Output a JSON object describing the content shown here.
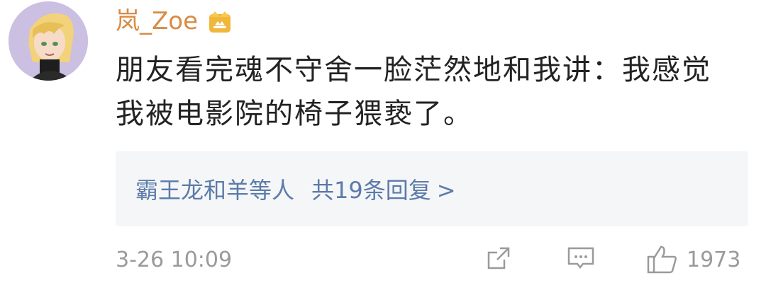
{
  "comment": {
    "username": "岚_Zoe",
    "text": "朋友看完魂不守舍一脸茫然地和我讲：我感觉我被电影院的椅子猥亵了。",
    "replies_names": "霸王龙和羊等人",
    "replies_count": "共19条回复",
    "replies_chevron": ">",
    "timestamp": "3-26 10:09",
    "likes": "1973"
  },
  "icons": {
    "badge": "crown-badge-icon",
    "share": "share-icon",
    "reply": "comment-icon",
    "like": "thumbs-up-icon"
  },
  "colors": {
    "username": "#d98a43",
    "link": "#5b7ba9",
    "meta": "#9a9a9a",
    "reply_bg": "#f5f6f8"
  }
}
